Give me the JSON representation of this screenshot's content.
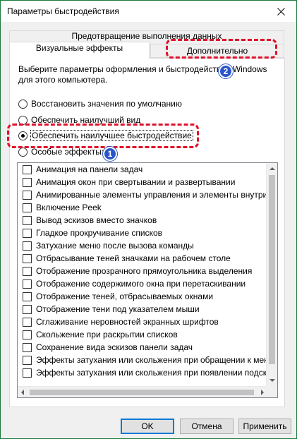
{
  "window": {
    "title": "Параметры быстродействия"
  },
  "tabs": {
    "dep": "Предотвращение выполнения данных",
    "visual": "Визуальные эффекты",
    "advanced": "Дополнительно"
  },
  "description": "Выберите параметры оформления и быстродействия Windows для этого компьютера.",
  "radios": [
    {
      "label": "Восстановить значения по умолчанию",
      "checked": false
    },
    {
      "label": "Обеспечить наилучший вид",
      "checked": false
    },
    {
      "label": "Обеспечить наилучшее быстродействие",
      "checked": true
    },
    {
      "label": "Особые эффекты:",
      "checked": false
    }
  ],
  "effects": [
    "Анимация на панели задач",
    "Анимация окон при свертывании и развертывании",
    "Анимированные элементы управления и элементы внутри окна",
    "Включение Peek",
    "Вывод эскизов вместо значков",
    "Гладкое прокручивание списков",
    "Затухание меню после вызова команды",
    "Отбрасывание теней значками на рабочем столе",
    "Отображение прозрачного прямоугольника выделения",
    "Отображение содержимого окна при перетаскивании",
    "Отображение теней, отбрасываемых окнами",
    "Отображение тени под указателем мыши",
    "Сглаживание неровностей экранных шрифтов",
    "Скольжение при раскрытии списков",
    "Сохранение вида эскизов панели задач",
    "Эффекты затухания или скольжения при обращении к меню",
    "Эффекты затухания или скольжения при появлении подсказок"
  ],
  "buttons": {
    "ok": "OK",
    "cancel": "Отмена",
    "apply": "Применить"
  },
  "annotations": {
    "badge1": "1",
    "badge2": "2"
  },
  "colors": {
    "annotation": "#e0112b",
    "badge": "#2a55c9",
    "focus": "#0078d7"
  }
}
